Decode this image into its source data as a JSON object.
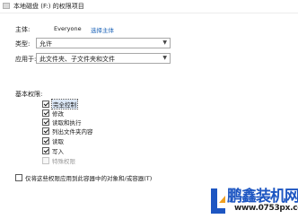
{
  "window": {
    "title": "本地磁盘 (F:) 的权限项目",
    "title_icon": "folder-permission-icon"
  },
  "principal": {
    "label": "主体:",
    "value": "Everyone",
    "link": "选择主体"
  },
  "type": {
    "label": "类型:",
    "selected": "允许"
  },
  "applies_to": {
    "label": "应用于:",
    "selected": "此文件夹、子文件夹和文件"
  },
  "basic_permissions": {
    "label": "基本权限:",
    "items": [
      {
        "label": "完全控制",
        "checked": true,
        "enabled": true,
        "focused": true
      },
      {
        "label": "修改",
        "checked": true,
        "enabled": true
      },
      {
        "label": "读取和执行",
        "checked": true,
        "enabled": true
      },
      {
        "label": "列出文件夹内容",
        "checked": true,
        "enabled": true
      },
      {
        "label": "读取",
        "checked": true,
        "enabled": true
      },
      {
        "label": "写入",
        "checked": true,
        "enabled": true
      },
      {
        "label": "特殊权限",
        "checked": false,
        "enabled": false
      }
    ]
  },
  "apply_inside": {
    "label": "仅将这些权限应用到此容器中的对象和/或容器(T)",
    "checked": false
  },
  "watermark": {
    "brand": "鹏鑫装机网",
    "url": "www.0753px.com",
    "color": "#1d56c2"
  }
}
